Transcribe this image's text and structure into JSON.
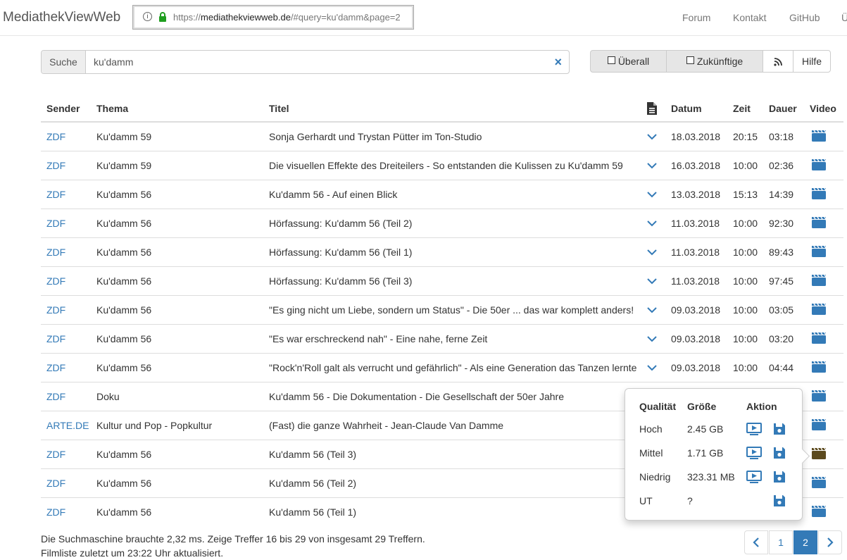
{
  "brand": "MediathekViewWeb",
  "url": {
    "prefix": "https://",
    "domain": "mediathekviewweb.de",
    "rest": "/#query=ku'damm&page=2"
  },
  "nav": {
    "forum": "Forum",
    "kontakt": "Kontakt",
    "github": "GitHub",
    "more": "Ü"
  },
  "search": {
    "addon": "Suche",
    "value": "ku'damm",
    "clear": "×"
  },
  "toolbar": {
    "everywhere": "Überall",
    "future": "Zukünftige",
    "help": "Hilfe"
  },
  "columns": {
    "sender": "Sender",
    "thema": "Thema",
    "titel": "Titel",
    "datum": "Datum",
    "zeit": "Zeit",
    "dauer": "Dauer",
    "video": "Video"
  },
  "rows": [
    {
      "sender": "ZDF",
      "thema": "Ku'damm 59",
      "titel": "Sonja Gerhardt und Trystan Pütter im Ton-Studio",
      "datum": "18.03.2018",
      "zeit": "20:15",
      "dauer": "03:18",
      "has_desc": true
    },
    {
      "sender": "ZDF",
      "thema": "Ku'damm 59",
      "titel": "Die visuellen Effekte des Dreiteilers - So entstanden die Kulissen zu Ku'damm 59",
      "datum": "16.03.2018",
      "zeit": "10:00",
      "dauer": "02:36",
      "has_desc": true
    },
    {
      "sender": "ZDF",
      "thema": "Ku'damm 56",
      "titel": "Ku'damm 56 - Auf einen Blick",
      "datum": "13.03.2018",
      "zeit": "15:13",
      "dauer": "14:39",
      "has_desc": true
    },
    {
      "sender": "ZDF",
      "thema": "Ku'damm 56",
      "titel": "Hörfassung: Ku'damm 56 (Teil 2)",
      "datum": "11.03.2018",
      "zeit": "10:00",
      "dauer": "92:30",
      "has_desc": true
    },
    {
      "sender": "ZDF",
      "thema": "Ku'damm 56",
      "titel": "Hörfassung: Ku'damm 56 (Teil 1)",
      "datum": "11.03.2018",
      "zeit": "10:00",
      "dauer": "89:43",
      "has_desc": true
    },
    {
      "sender": "ZDF",
      "thema": "Ku'damm 56",
      "titel": "Hörfassung: Ku'damm 56 (Teil 3)",
      "datum": "11.03.2018",
      "zeit": "10:00",
      "dauer": "97:45",
      "has_desc": true
    },
    {
      "sender": "ZDF",
      "thema": "Ku'damm 56",
      "titel": "\"Es ging nicht um Liebe, sondern um Status\" - Die 50er ... das war komplett anders!",
      "datum": "09.03.2018",
      "zeit": "10:00",
      "dauer": "03:05",
      "has_desc": true
    },
    {
      "sender": "ZDF",
      "thema": "Ku'damm 56",
      "titel": "\"Es war erschreckend nah\" - Eine nahe, ferne Zeit",
      "datum": "09.03.2018",
      "zeit": "10:00",
      "dauer": "03:20",
      "has_desc": true
    },
    {
      "sender": "ZDF",
      "thema": "Ku'damm 56",
      "titel": "\"Rock'n'Roll galt als verrucht und gefährlich\" - Als eine Generation das Tanzen lernte",
      "datum": "09.03.2018",
      "zeit": "10:00",
      "dauer": "04:44",
      "has_desc": true
    },
    {
      "sender": "ZDF",
      "thema": "Doku",
      "titel": "Ku'damm 56 - Die Dokumentation - Die Gesellschaft der 50er Jahre",
      "datum": "",
      "zeit": "",
      "dauer": "",
      "has_desc": false
    },
    {
      "sender": "ARTE.DE",
      "thema": "Kultur und Pop - Popkultur",
      "titel": "(Fast) die ganze Wahrheit - Jean-Claude Van Damme",
      "datum": "",
      "zeit": "",
      "dauer": "",
      "has_desc": false
    },
    {
      "sender": "ZDF",
      "thema": "Ku'damm 56",
      "titel": "Ku'damm 56 (Teil 3)",
      "datum": "",
      "zeit": "",
      "dauer": "",
      "has_desc": false,
      "active": true
    },
    {
      "sender": "ZDF",
      "thema": "Ku'damm 56",
      "titel": "Ku'damm 56 (Teil 2)",
      "datum": "",
      "zeit": "",
      "dauer": "",
      "has_desc": false
    },
    {
      "sender": "ZDF",
      "thema": "Ku'damm 56",
      "titel": "Ku'damm 56 (Teil 1)",
      "datum": "",
      "zeit": "",
      "dauer": "",
      "has_desc": false
    }
  ],
  "status": {
    "line1": "Die Suchmaschine brauchte 2,32 ms. Zeige Treffer 16 bis 29 von insgesamt 29 Treffern.",
    "line2": "Filmliste zuletzt um 23:22 Uhr aktualisiert."
  },
  "pagination": {
    "prev": "‹",
    "pages": [
      "1",
      "2"
    ],
    "active": "2",
    "next": "›"
  },
  "popover": {
    "headers": {
      "quality": "Qualität",
      "size": "Größe",
      "action": "Aktion"
    },
    "rows": [
      {
        "quality": "Hoch",
        "size": "2.45 GB",
        "play": true
      },
      {
        "quality": "Mittel",
        "size": "1.71 GB",
        "play": true
      },
      {
        "quality": "Niedrig",
        "size": "323.31 MB",
        "play": true
      },
      {
        "quality": "UT",
        "size": "?",
        "play": false
      }
    ]
  },
  "colors": {
    "link": "#337ab7",
    "active_video": "#5c4a1e",
    "table_border": "#dddddd"
  }
}
